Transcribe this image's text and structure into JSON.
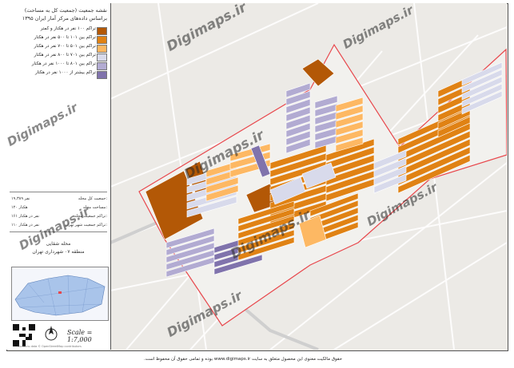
{
  "sidebar": {
    "title_line1": "نقشه جمعیت (جمعیت کل به مساحت)",
    "title_line2": "براساس داده‌های مرکز آمار ایران ۱۳۹۵",
    "legend": [
      {
        "label": "تراکم ۱۰۰ نفر در هکتار و کمتر",
        "color": "#b35806"
      },
      {
        "label": "تراکم بین ۱۰۱ تا ۵۰۰ نفر در هکتار",
        "color": "#e08214"
      },
      {
        "label": "تراکم بین ۵۰۱ تا ۷۰۰ نفر در هکتار",
        "color": "#fdb863"
      },
      {
        "label": "تراکم بین ۷۰۱ تا ۸۰۰ نفر در هکتار",
        "color": "#d8daeb"
      },
      {
        "label": "تراکم بین ۸۰۱ تا ۱۰۰۰ نفر در هکتار",
        "color": "#b2abd2"
      },
      {
        "label": "تراکم بیشتر از ۱۰۰۰ نفر در هکتار",
        "color": "#8073ac"
      }
    ],
    "stats": [
      {
        "label": "جمعیت کل محله:",
        "value": "۱۹,۳۸۹ نفر"
      },
      {
        "label": "مساحت محله:",
        "value": "۱۲۰ هکتار"
      },
      {
        "label": "تراکم جمعیت محله:",
        "value": "۱۶۱ نفر در هکتار"
      },
      {
        "label": "تراکم جمعیت شهر تهران:",
        "value": "۱۱۰ نفر در هکتار"
      }
    ],
    "place_line1": "محله شقایی",
    "place_line2": "منطقه ۰۷ شهرداری تهران",
    "scale": "Scale = 1:7,000",
    "credit": "Contains data © OpenStreetMap contributors"
  },
  "watermark": "Digimaps.ir",
  "footer": "حقوق مالکیت معنوی این محصول متعلق به سایت www.digimaps.ir بوده و تمامی حقوق آن محفوظ است.",
  "colors": {
    "very_low": "#b35806",
    "low": "#e08214",
    "mid": "#fdb863",
    "mid_high": "#d8daeb",
    "high": "#b2abd2",
    "very_high": "#8073ac",
    "boundary": "#e8474c"
  }
}
